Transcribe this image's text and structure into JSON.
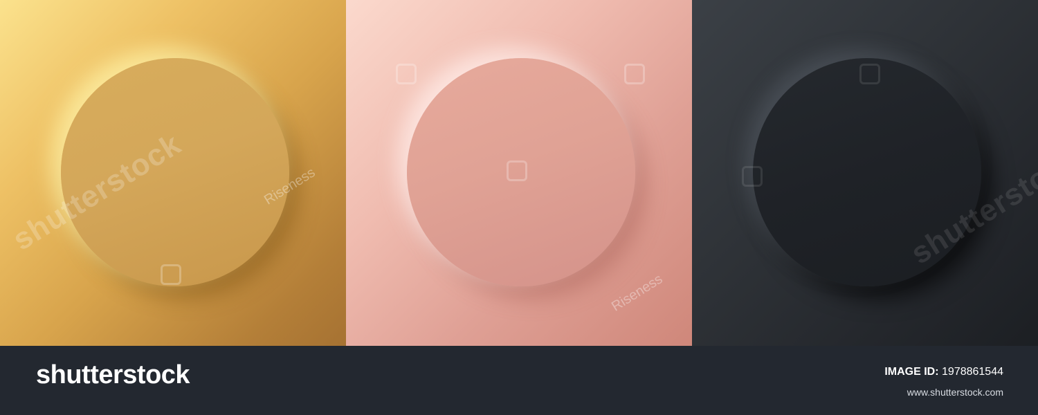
{
  "watermark": {
    "brand": "shutterstock",
    "contributor": "Riseness"
  },
  "panels": [
    {
      "name": "gold",
      "disc_color": "#d4a75a",
      "background_color": "#e2b25a"
    },
    {
      "name": "rose-gold",
      "disc_color": "#e0a295",
      "background_color": "#ebb4a8"
    },
    {
      "name": "black",
      "disc_color": "#1f2227",
      "background_color": "#2d3136"
    }
  ],
  "footer": {
    "logo_text": "shutterstock",
    "image_id_label": "IMAGE ID:",
    "image_id_value": "1978861544",
    "site_url": "www.shutterstock.com"
  },
  "colors": {
    "footer_bg": "#232830",
    "text": "#ffffff"
  }
}
